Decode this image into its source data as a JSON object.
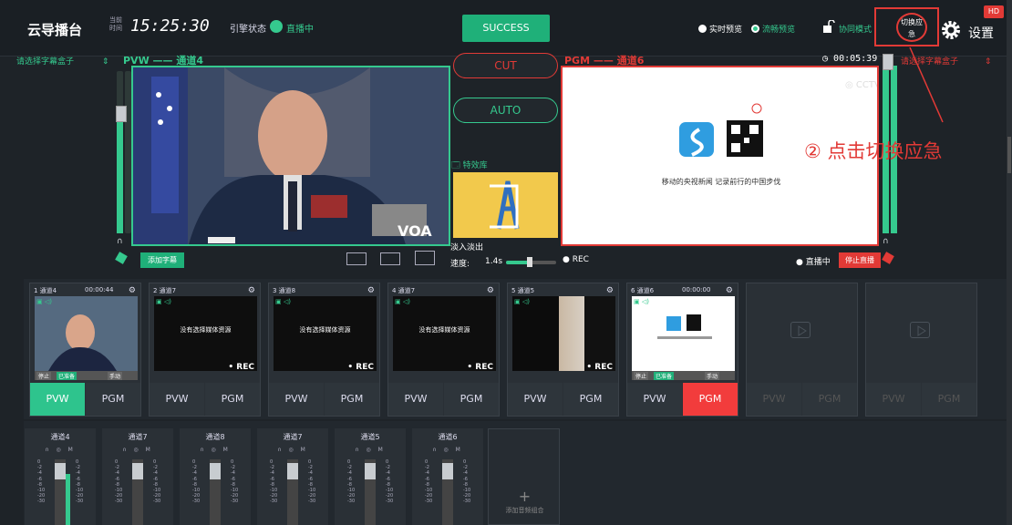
{
  "header": {
    "app_title": "云导播台",
    "time_label": "当前时间",
    "clock": "15:25:30",
    "stream_status_label": "引擎状态",
    "stream_status": "直播中",
    "success_label": "SUCCESS",
    "realtime_preview": "实时预览",
    "smooth_preview": "流畅预览",
    "collab_mode": "协同模式",
    "switch_emergency": "切换应急",
    "settings": "设置",
    "hd": "HD"
  },
  "preview": {
    "subtitle_select": "请选择字幕盒子",
    "pvw_title": "PVW —— 通道4",
    "add_subtitle": "添加字幕"
  },
  "program": {
    "pgm_title": "PGM —— 通道6",
    "timer": "00:05:39",
    "subtitle_select": "请选择字幕盒子",
    "caption": "移动的央视新闻 记录前行的中国步伐",
    "rec": "REC",
    "live": "直播中",
    "stop_live": "停止直播"
  },
  "switcher": {
    "cut": "CUT",
    "auto": "AUTO",
    "fx_library": "特效库",
    "fx_name": "淡入淡出",
    "speed_label": "速度:",
    "speed_value": "1.4s",
    "speed_level": 0.47
  },
  "annotation": {
    "text": "② 点击切换应急"
  },
  "channels": [
    {
      "title": "1 通道4",
      "time": "00:00:44",
      "has_media": true,
      "rec": "",
      "status": [
        "停止",
        "已准备",
        "手动"
      ],
      "pvw": "PVW",
      "pgm": "PGM",
      "pvw_active": true,
      "pgm_active": false
    },
    {
      "title": "2 通道7",
      "time": "",
      "has_media": false,
      "no_media": "没有选择媒体资源",
      "rec": "• REC",
      "pvw": "PVW",
      "pgm": "PGM"
    },
    {
      "title": "3 通道8",
      "time": "",
      "has_media": false,
      "no_media": "没有选择媒体资源",
      "rec": "• REC",
      "pvw": "PVW",
      "pgm": "PGM"
    },
    {
      "title": "4 通道7",
      "time": "",
      "has_media": false,
      "no_media": "没有选择媒体资源",
      "rec": "• REC",
      "pvw": "PVW",
      "pgm": "PGM"
    },
    {
      "title": "5 通道5",
      "time": "",
      "has_media": true,
      "rec": "• REC",
      "pvw": "PVW",
      "pgm": "PGM"
    },
    {
      "title": "6 通道6",
      "time": "00:00:00",
      "has_media": true,
      "rec": "",
      "status": [
        "停止",
        "已准备",
        "手动"
      ],
      "pvw": "PVW",
      "pgm": "PGM",
      "pvw_active": false,
      "pgm_active": true
    },
    {
      "title": "",
      "empty": true,
      "pvw": "PVW",
      "pgm": "PGM"
    },
    {
      "title": "",
      "empty": true,
      "pvw": "PVW",
      "pgm": "PGM"
    }
  ],
  "audio": {
    "mixers": [
      "通道4",
      "通道7",
      "通道8",
      "通道7",
      "通道5",
      "通道6"
    ],
    "icons": "∩ ◎ M",
    "scale": [
      "0",
      "-2",
      "-4",
      "-6",
      "-8",
      "-10",
      "-20",
      "-30"
    ],
    "add_label": "添加音频组合",
    "add_plus": "+"
  },
  "colors": {
    "accent_green": "#35c98e",
    "accent_red": "#e23a36"
  }
}
